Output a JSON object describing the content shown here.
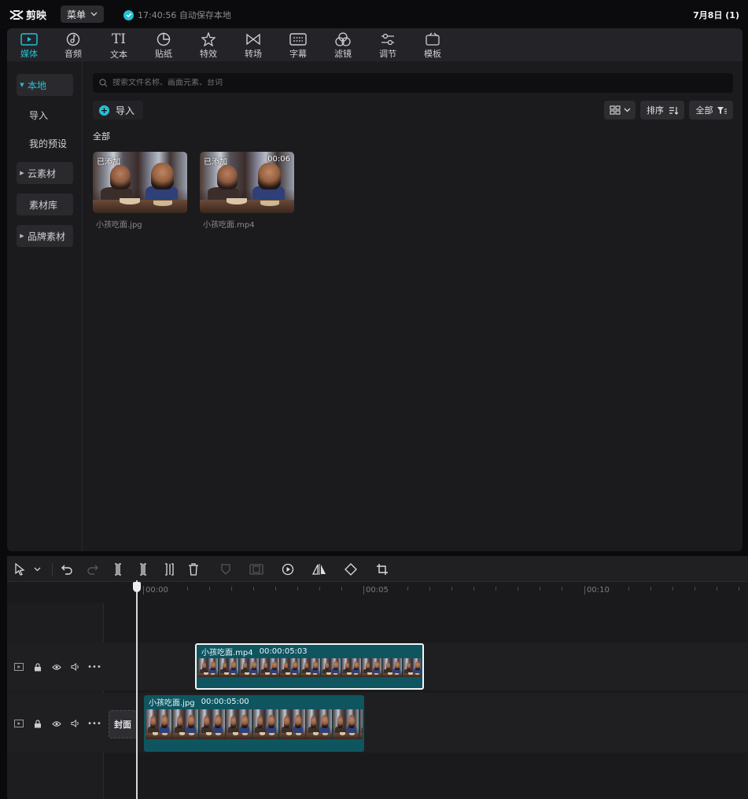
{
  "app": {
    "logo_text": "剪映",
    "menu_label": "菜单",
    "save_status": "17:40:56 自动保存本地",
    "project_title": "7月8日 (1)"
  },
  "toolbar": {
    "tabs": [
      {
        "label": "媒体",
        "icon": "media-icon",
        "active": true
      },
      {
        "label": "音频",
        "icon": "audio-icon"
      },
      {
        "label": "文本",
        "icon": "text-icon"
      },
      {
        "label": "贴纸",
        "icon": "sticker-icon"
      },
      {
        "label": "特效",
        "icon": "effects-icon"
      },
      {
        "label": "转场",
        "icon": "transition-icon"
      },
      {
        "label": "字幕",
        "icon": "subtitle-icon"
      },
      {
        "label": "滤镜",
        "icon": "filter-icon"
      },
      {
        "label": "调节",
        "icon": "adjust-icon"
      },
      {
        "label": "模板",
        "icon": "template-icon"
      }
    ]
  },
  "sidebar": {
    "items": [
      {
        "label": "本地",
        "expandable": true,
        "active": true
      },
      {
        "label": "导入"
      },
      {
        "label": "我的预设"
      },
      {
        "label": "云素材",
        "expandable": true
      },
      {
        "label": "素材库"
      },
      {
        "label": "品牌素材",
        "expandable": true
      }
    ]
  },
  "library": {
    "search_placeholder": "搜索文件名称、画面元素、台词",
    "import_label": "导入",
    "sort_label": "排序",
    "filter_label": "全部",
    "section_label": "全部",
    "items": [
      {
        "name": "小孩吃面.jpg",
        "badge": "已添加",
        "duration": ""
      },
      {
        "name": "小孩吃面.mp4",
        "badge": "已添加",
        "duration": "00:06"
      }
    ]
  },
  "timeline": {
    "ruler_labels": [
      "00:00",
      "00:05",
      "00:10"
    ],
    "cover_label": "封面",
    "clips": [
      {
        "name": "小孩吃面.mp4",
        "duration": "00:00:05:03",
        "selected": true
      },
      {
        "name": "小孩吃面.jpg",
        "duration": "00:00:05:00"
      }
    ]
  },
  "colors": {
    "accent": "#22c1d4",
    "clip": "#0e5560",
    "background": "#1b1b1d"
  }
}
